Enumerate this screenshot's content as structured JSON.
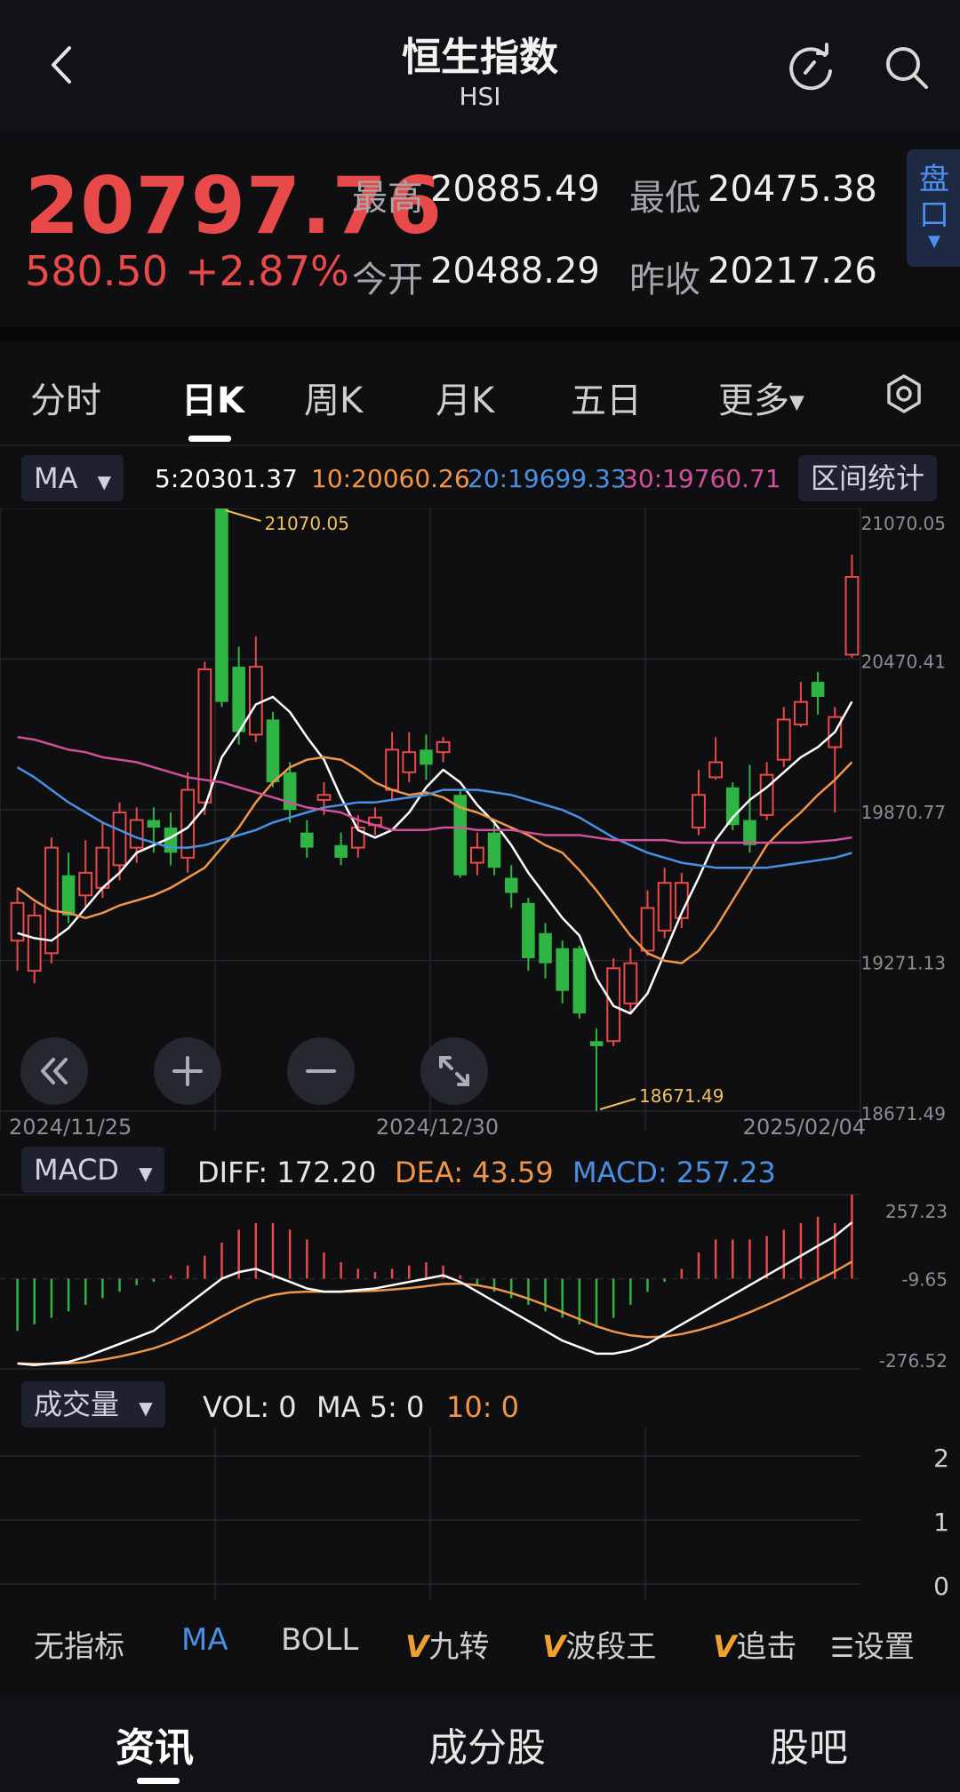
{
  "header": {
    "title": "恒生指数",
    "subtitle": "HSI"
  },
  "quote": {
    "price": "20797.76",
    "change": "580.50",
    "change_pct": "+2.87%",
    "high_label": "最高",
    "high": "20885.49",
    "low_label": "最低",
    "low": "20475.38",
    "open_label": "今开",
    "open": "20488.29",
    "prev_label": "昨收",
    "prev": "20217.26",
    "panel_label": "盘口"
  },
  "tabs": [
    {
      "label": "分时"
    },
    {
      "label": "日K"
    },
    {
      "label": "周K"
    },
    {
      "label": "月K"
    },
    {
      "label": "五日"
    },
    {
      "label": "更多"
    }
  ],
  "ma_bar": {
    "selector": "MA",
    "ma5": "5:20301.37",
    "ma10": "10:20060.26",
    "ma20": "20:19699.33",
    "ma30": "30:19760.71",
    "range_button": "区间统计"
  },
  "colors": {
    "up": "#e84a4a",
    "down": "#2fb544",
    "ma5": "#ffffff",
    "ma10": "#f0964a",
    "ma20": "#4a90e2",
    "ma30": "#d0509a"
  },
  "chart_data": [
    {
      "type": "candlestick",
      "x_labels": [
        "2024/11/25",
        "2024/12/30",
        "2025/02/04"
      ],
      "y_axis_labels": [
        "21070.05",
        "20470.41",
        "19870.77",
        "19271.13",
        "18671.49"
      ],
      "ylim": [
        18671.49,
        21070.05
      ],
      "annotations": [
        {
          "text": "21070.05",
          "kind": "high"
        },
        {
          "text": "18671.49",
          "kind": "low"
        }
      ],
      "candles": [
        {
          "o": 19350,
          "c": 19500,
          "h": 19560,
          "l": 19230
        },
        {
          "o": 19230,
          "c": 19450,
          "h": 19500,
          "l": 19180
        },
        {
          "o": 19300,
          "c": 19720,
          "h": 19760,
          "l": 19260
        },
        {
          "o": 19610,
          "c": 19450,
          "h": 19700,
          "l": 19420
        },
        {
          "o": 19530,
          "c": 19620,
          "h": 19750,
          "l": 19480
        },
        {
          "o": 19560,
          "c": 19720,
          "h": 19820,
          "l": 19520
        },
        {
          "o": 19650,
          "c": 19860,
          "h": 19900,
          "l": 19590
        },
        {
          "o": 19720,
          "c": 19830,
          "h": 19880,
          "l": 19660
        },
        {
          "o": 19830,
          "c": 19800,
          "h": 19880,
          "l": 19700
        },
        {
          "o": 19800,
          "c": 19700,
          "h": 19860,
          "l": 19650
        },
        {
          "o": 19680,
          "c": 19950,
          "h": 20020,
          "l": 19620
        },
        {
          "o": 19900,
          "c": 20430,
          "h": 20460,
          "l": 19850
        },
        {
          "o": 21070,
          "c": 20300,
          "h": 21070,
          "l": 20280
        },
        {
          "o": 20440,
          "c": 20180,
          "h": 20520,
          "l": 20130
        },
        {
          "o": 20170,
          "c": 20440,
          "h": 20560,
          "l": 20140
        },
        {
          "o": 20230,
          "c": 19980,
          "h": 20260,
          "l": 19960
        },
        {
          "o": 20020,
          "c": 19870,
          "h": 20060,
          "l": 19820
        },
        {
          "o": 19780,
          "c": 19720,
          "h": 19830,
          "l": 19680
        },
        {
          "o": 19910,
          "c": 19930,
          "h": 19980,
          "l": 19850
        },
        {
          "o": 19730,
          "c": 19680,
          "h": 19780,
          "l": 19650
        },
        {
          "o": 19720,
          "c": 19800,
          "h": 19850,
          "l": 19680
        },
        {
          "o": 19810,
          "c": 19840,
          "h": 19880,
          "l": 19770
        },
        {
          "o": 19950,
          "c": 20110,
          "h": 20180,
          "l": 19910
        },
        {
          "o": 20020,
          "c": 20100,
          "h": 20180,
          "l": 19980
        },
        {
          "o": 20110,
          "c": 20050,
          "h": 20170,
          "l": 19990
        },
        {
          "o": 20100,
          "c": 20140,
          "h": 20160,
          "l": 20060
        },
        {
          "o": 19930,
          "c": 19610,
          "h": 19950,
          "l": 19600
        },
        {
          "o": 19660,
          "c": 19720,
          "h": 19780,
          "l": 19610
        },
        {
          "o": 19780,
          "c": 19640,
          "h": 19830,
          "l": 19610
        },
        {
          "o": 19600,
          "c": 19540,
          "h": 19650,
          "l": 19480
        },
        {
          "o": 19500,
          "c": 19280,
          "h": 19520,
          "l": 19230
        },
        {
          "o": 19380,
          "c": 19260,
          "h": 19420,
          "l": 19200
        },
        {
          "o": 19320,
          "c": 19150,
          "h": 19350,
          "l": 19100
        },
        {
          "o": 19320,
          "c": 19060,
          "h": 19330,
          "l": 19040
        },
        {
          "o": 18950,
          "c": 18930,
          "h": 19000,
          "l": 18671.49
        },
        {
          "o": 18950,
          "c": 19240,
          "h": 19280,
          "l": 18930
        },
        {
          "o": 19100,
          "c": 19260,
          "h": 19320,
          "l": 19060
        },
        {
          "o": 19310,
          "c": 19480,
          "h": 19550,
          "l": 19290
        },
        {
          "o": 19390,
          "c": 19580,
          "h": 19640,
          "l": 19360
        },
        {
          "o": 19440,
          "c": 19580,
          "h": 19620,
          "l": 19400
        },
        {
          "o": 19800,
          "c": 19930,
          "h": 20030,
          "l": 19770
        },
        {
          "o": 20000,
          "c": 20060,
          "h": 20160,
          "l": 19990
        },
        {
          "o": 19960,
          "c": 19810,
          "h": 19980,
          "l": 19790
        },
        {
          "o": 19830,
          "c": 19730,
          "h": 20050,
          "l": 19700
        },
        {
          "o": 19850,
          "c": 20010,
          "h": 20060,
          "l": 19830
        },
        {
          "o": 20070,
          "c": 20230,
          "h": 20280,
          "l": 20040
        },
        {
          "o": 20210,
          "c": 20300,
          "h": 20380,
          "l": 20200
        },
        {
          "o": 20380,
          "c": 20320,
          "h": 20420,
          "l": 20250
        },
        {
          "o": 20120,
          "c": 20240,
          "h": 20280,
          "l": 19860
        },
        {
          "o": 20488.29,
          "c": 20797.76,
          "h": 20885.49,
          "l": 20475.38
        }
      ],
      "series": [
        {
          "name": "5",
          "values": [
            19380,
            19360,
            19350,
            19400,
            19480,
            19560,
            19620,
            19700,
            19730,
            19760,
            19800,
            19880,
            20080,
            20180,
            20290,
            20320,
            20260,
            20160,
            20070,
            19920,
            19790,
            19760,
            19790,
            19860,
            19960,
            20030,
            19980,
            19890,
            19820,
            19730,
            19620,
            19530,
            19440,
            19370,
            19200,
            19090,
            19060,
            19140,
            19300,
            19460,
            19600,
            19750,
            19840,
            19910,
            19960,
            20020,
            20080,
            20120,
            20180,
            20301.37
          ]
        },
        {
          "name": "10",
          "values": [
            19560,
            19510,
            19470,
            19460,
            19440,
            19460,
            19490,
            19510,
            19530,
            19560,
            19600,
            19640,
            19720,
            19800,
            19900,
            19980,
            20040,
            20070,
            20080,
            20070,
            20030,
            19980,
            19950,
            19930,
            19940,
            19920,
            19880,
            19860,
            19830,
            19800,
            19770,
            19730,
            19700,
            19630,
            19550,
            19460,
            19370,
            19300,
            19270,
            19260,
            19310,
            19400,
            19510,
            19620,
            19730,
            19800,
            19860,
            19930,
            19990,
            20060.26
          ]
        },
        {
          "name": "20",
          "values": [
            20040,
            20000,
            19950,
            19900,
            19860,
            19820,
            19790,
            19760,
            19740,
            19720,
            19720,
            19730,
            19750,
            19770,
            19790,
            19820,
            19840,
            19860,
            19880,
            19890,
            19900,
            19900,
            19910,
            19920,
            19930,
            19950,
            19950,
            19950,
            19940,
            19930,
            19910,
            19890,
            19870,
            19840,
            19800,
            19760,
            19730,
            19700,
            19680,
            19660,
            19650,
            19640,
            19640,
            19640,
            19640,
            19650,
            19660,
            19670,
            19680,
            19699.33
          ]
        },
        {
          "name": "30",
          "values": [
            20160,
            20150,
            20130,
            20110,
            20100,
            20080,
            20070,
            20060,
            20040,
            20020,
            20000,
            19990,
            19980,
            19960,
            19940,
            19920,
            19900,
            19880,
            19870,
            19860,
            19830,
            19810,
            19790,
            19790,
            19790,
            19800,
            19800,
            19790,
            19790,
            19790,
            19780,
            19770,
            19770,
            19770,
            19760,
            19750,
            19750,
            19750,
            19750,
            19740,
            19740,
            19740,
            19740,
            19740,
            19740,
            19740,
            19740,
            19745,
            19750,
            19760.71
          ]
        }
      ]
    },
    {
      "type": "bar",
      "name": "MACD",
      "header": {
        "selector": "MACD",
        "diff": "DIFF: 172.20",
        "dea": "DEA: 43.59",
        "macd": "MACD: 257.23"
      },
      "y_axis_labels": [
        "257.23",
        "-9.65",
        "-276.52"
      ],
      "ylim": [
        -276.52,
        257.23
      ],
      "hist": [
        -160,
        -140,
        -120,
        -100,
        -80,
        -60,
        -40,
        -20,
        -10,
        10,
        40,
        70,
        110,
        150,
        170,
        170,
        150,
        120,
        80,
        50,
        30,
        20,
        30,
        40,
        50,
        40,
        10,
        -20,
        -40,
        -60,
        -80,
        -100,
        -120,
        -140,
        -150,
        -120,
        -80,
        -40,
        -10,
        30,
        80,
        120,
        120,
        120,
        130,
        150,
        170,
        190,
        170,
        257.23
      ],
      "diff": [
        -260,
        -265,
        -260,
        -255,
        -240,
        -220,
        -200,
        -180,
        -160,
        -120,
        -80,
        -40,
        0,
        20,
        30,
        10,
        -10,
        -30,
        -40,
        -40,
        -35,
        -30,
        -20,
        -10,
        0,
        10,
        -10,
        -40,
        -70,
        -100,
        -130,
        -160,
        -190,
        -210,
        -230,
        -230,
        -220,
        -200,
        -170,
        -140,
        -110,
        -80,
        -50,
        -20,
        10,
        40,
        70,
        100,
        130,
        172.2
      ]
    },
    {
      "type": "bar",
      "name": "VOL",
      "header": {
        "selector": "成交量",
        "vol": "VOL: 0",
        "ma5": "MA 5: 0",
        "ma10": "10: 0"
      },
      "y_axis_labels": [
        "2",
        "1",
        "0"
      ]
    }
  ],
  "indicators": [
    {
      "label": "无指标"
    },
    {
      "label": "MA"
    },
    {
      "label": "BOLL"
    },
    {
      "label": "九转"
    },
    {
      "label": "波段王"
    },
    {
      "label": "追击"
    }
  ],
  "settings_label": "设置",
  "bottom_nav": [
    {
      "label": "资讯"
    },
    {
      "label": "成分股"
    },
    {
      "label": "股吧"
    }
  ]
}
